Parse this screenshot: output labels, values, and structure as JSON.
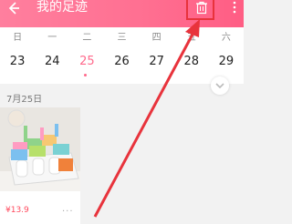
{
  "header": {
    "title": "我的足迹",
    "back_icon": "arrow-left-icon",
    "delete_icon": "trash-icon",
    "more_icon": "more-vertical-icon",
    "gradient": [
      "#ff7f9e",
      "#ff5d84"
    ]
  },
  "calendar": {
    "weekdays": [
      "日",
      "一",
      "二",
      "三",
      "四",
      "五",
      "六"
    ],
    "dates": [
      "23",
      "24",
      "25",
      "26",
      "27",
      "28",
      "29"
    ],
    "selected": "25",
    "accent": "#ff6a8c",
    "expand_icon": "chevron-down-icon"
  },
  "section": {
    "date_label": "7月25日"
  },
  "items": [
    {
      "price": "¥13.9",
      "more": "···"
    }
  ],
  "annotation": {
    "highlight_color": "#e8333c",
    "arrow_color": "#e8333c"
  }
}
